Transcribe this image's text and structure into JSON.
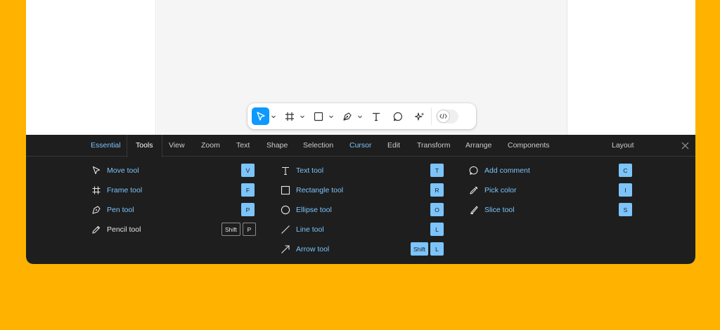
{
  "toolbar": {
    "tools": [
      {
        "name": "move",
        "icon": "cursor-arrow-icon",
        "active": true
      },
      {
        "name": "frame",
        "icon": "frame-hash-icon"
      },
      {
        "name": "shape",
        "icon": "rectangle-icon"
      },
      {
        "name": "pen",
        "icon": "pen-nib-icon"
      },
      {
        "name": "text",
        "icon": "text-t-icon"
      },
      {
        "name": "comment",
        "icon": "comment-bubble-icon"
      },
      {
        "name": "actions",
        "icon": "sparkle-actions-icon"
      }
    ],
    "dev_mode_icon": "code-brackets-icon",
    "accent": "#0d99ff"
  },
  "shortcuts_panel": {
    "tabs": [
      {
        "label": "Essential",
        "style": "blue"
      },
      {
        "label": "Tools",
        "style": "selected"
      },
      {
        "label": "View"
      },
      {
        "label": "Zoom"
      },
      {
        "label": "Text"
      },
      {
        "label": "Shape"
      },
      {
        "label": "Selection"
      },
      {
        "label": "Cursor",
        "style": "blue"
      },
      {
        "label": "Edit"
      },
      {
        "label": "Transform"
      },
      {
        "label": "Arrange"
      },
      {
        "label": "Components"
      },
      {
        "label": "Layout"
      }
    ],
    "columns": [
      [
        {
          "label": "Move tool",
          "icon": "cursor-arrow-icon",
          "keys": [
            "V"
          ]
        },
        {
          "label": "Frame tool",
          "icon": "frame-hash-icon",
          "keys": [
            "F"
          ]
        },
        {
          "label": "Pen tool",
          "icon": "pen-nib-icon",
          "keys": [
            "P"
          ]
        },
        {
          "label": "Pencil tool",
          "icon": "pencil-icon",
          "keys": [
            "Shift",
            "P"
          ],
          "dim": true
        }
      ],
      [
        {
          "label": "Text tool",
          "icon": "text-t-icon",
          "keys": [
            "T"
          ]
        },
        {
          "label": "Rectangle tool",
          "icon": "rectangle-icon",
          "keys": [
            "R"
          ]
        },
        {
          "label": "Ellipse tool",
          "icon": "ellipse-icon",
          "keys": [
            "O"
          ]
        },
        {
          "label": "Line tool",
          "icon": "line-icon",
          "keys": [
            "L"
          ]
        },
        {
          "label": "Arrow tool",
          "icon": "arrow-icon",
          "keys": [
            "Shift",
            "L"
          ]
        }
      ],
      [
        {
          "label": "Add comment",
          "icon": "comment-bubble-icon",
          "keys": [
            "C"
          ]
        },
        {
          "label": "Pick color",
          "icon": "eyedropper-icon",
          "keys": [
            "I"
          ]
        },
        {
          "label": "Slice tool",
          "icon": "slice-knife-icon",
          "keys": [
            "S"
          ]
        }
      ]
    ],
    "close_icon": "close-icon",
    "colors": {
      "panel_bg": "#1e1e1e",
      "highlight": "#7cc4fa",
      "page_bg": "#FFB300"
    }
  }
}
